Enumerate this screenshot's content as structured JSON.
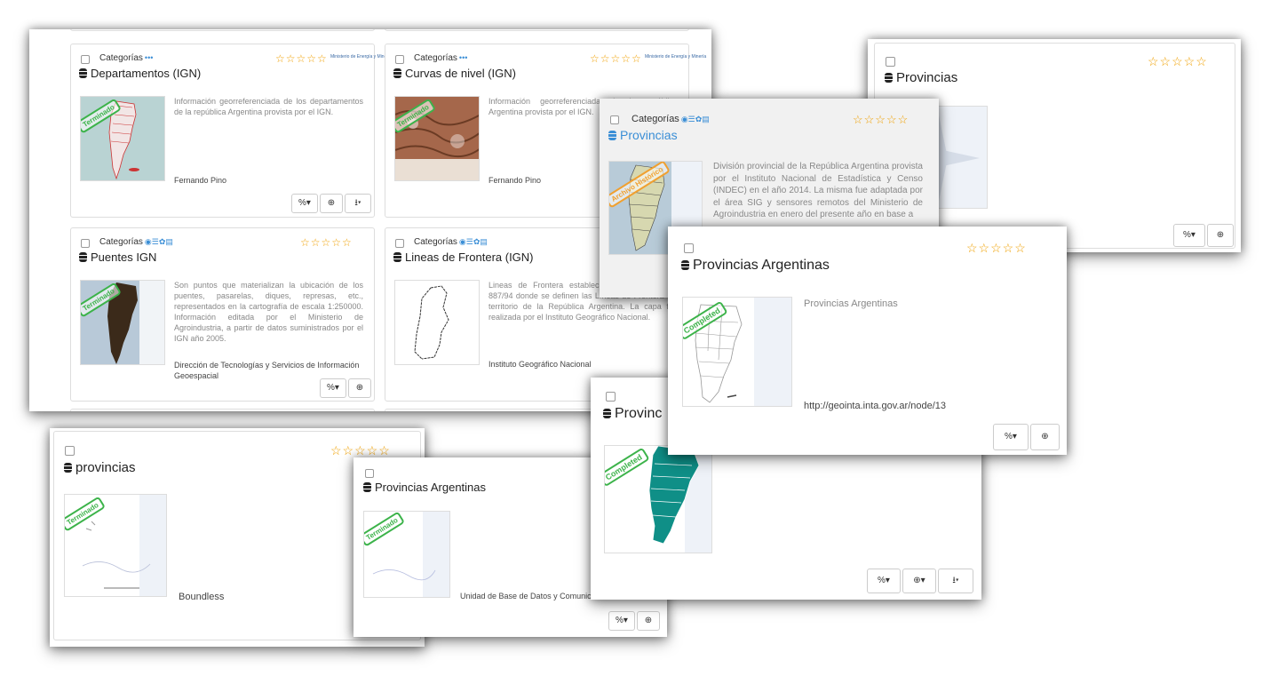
{
  "common": {
    "categories_label": "Categorías",
    "stars": "☆☆☆☆☆",
    "btn_link": "%▾",
    "btn_globe": "⊕",
    "btn_globe_menu": "⊕▾",
    "btn_download": "⭳▾",
    "cat_icons_more": "•••",
    "cat_icons_full": "◉☰✿▤",
    "ministry_logo": "Ministerio de Energía y Minería"
  },
  "cards": {
    "departamentos": {
      "title": "Departamentos (IGN)",
      "description": "Información georreferenciada de los departamentos de la república Argentina provista por el IGN.",
      "author": "Fernando Pino",
      "stamp": "Terminado"
    },
    "curvas": {
      "title": "Curvas de nivel (IGN)",
      "description": "Información georreferenciada de la república Argentina provista por el IGN.",
      "author": "Fernando Pino",
      "stamp": "Terminado"
    },
    "puentes": {
      "title": "Puentes IGN",
      "description": "Son puntos que materializan la ubicación de los puentes, pasarelas, diques, represas, etc., representados en la cartografía de escala 1:250000. Información editada por el Ministerio de Agroindustria, a partir de datos suministrados por el IGN año 2005.",
      "author": "Dirección de Tecnologías y Servicios de Información Geoespacial",
      "stamp": "Terminado"
    },
    "frontera": {
      "title": "Lineas de Frontera (IGN)",
      "description": "Lineas de Frontera establecidas por el Decreto 887/94 donde se definen las Líneas de Frontera del territorio de la República Argentina. La capa fue realizada por el Instituto Geográfico Nacional.",
      "author": "Instituto Geográfico Nacional"
    },
    "provincias_gray": {
      "title": "Provincias"
    },
    "provincias_blue": {
      "title": "Provincias",
      "description": "División provincial de la República Argentina provista por el Instituto Nacional de Estadística y Censo (INDEC) en el año 2014. La misma fue adaptada por el área SIG y sensores remotos del Ministerio de Agroindustria en enero del presente año en base a",
      "stamp": "Archivo Histórico"
    },
    "prov_arg_big": {
      "title": "Provincias Argentinas",
      "description": "Provincias Argentinas",
      "author": "http://geointa.inta.gov.ar/node/13",
      "stamp": "Completed"
    },
    "provincias_lower": {
      "title": "provincias",
      "author": "Boundless",
      "stamp": "Terminado"
    },
    "prov_arg_small": {
      "title": "Provincias Argentinas",
      "author": "Unidad de Base de Datos y Comunic",
      "stamp": "Terminado"
    },
    "provinc_teal": {
      "title": "Provinc",
      "stamp": "Completed"
    }
  }
}
